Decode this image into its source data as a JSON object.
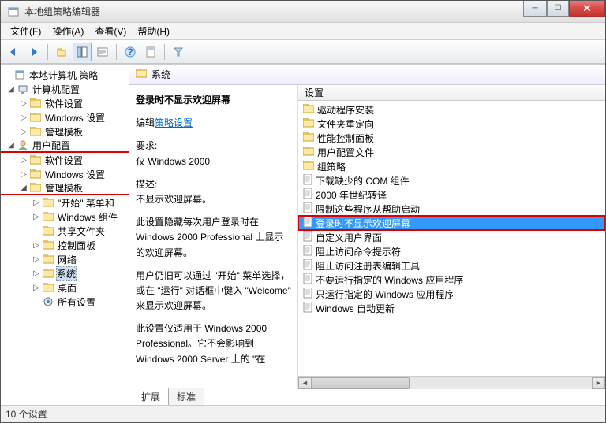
{
  "window": {
    "title": "本地组策略编辑器"
  },
  "menu": {
    "file": "文件(F)",
    "action": "操作(A)",
    "view": "查看(V)",
    "help": "帮助(H)"
  },
  "tree": {
    "root": "本地计算机 策略",
    "computer": "计算机配置",
    "c_soft": "软件设置",
    "c_win": "Windows 设置",
    "c_tmpl": "管理模板",
    "user": "用户配置",
    "u_soft": "软件设置",
    "u_win": "Windows 设置",
    "u_tmpl": "管理模板",
    "t_start": "\"开始\" 菜单和",
    "t_wincomp": "Windows 组件",
    "t_share": "共享文件夹",
    "t_ctrl": "控制面板",
    "t_net": "网络",
    "t_sys": "系统",
    "t_desk": "桌面",
    "t_all": "所有设置"
  },
  "header": {
    "title": "系统"
  },
  "desc": {
    "title": "登录时不显示欢迎屏幕",
    "edit_label": "编辑",
    "edit_link": "策略设置",
    "req_label": "要求:",
    "req_text": "仅 Windows 2000",
    "desc_label": "描述:",
    "desc_text": "不显示欢迎屏幕。",
    "p1": "此设置隐藏每次用户登录时在 Windows 2000 Professional 上显示的欢迎屏幕。",
    "p2": "用户仍旧可以通过 \"开始\" 菜单选择，或在 \"运行\" 对话框中键入 \"Welcome\" 来显示欢迎屏幕。",
    "p3": "此设置仅适用于 Windows 2000 Professional。它不会影响到 Windows 2000 Server 上的 \"在"
  },
  "list": {
    "header": "设置",
    "items": [
      {
        "t": "folder",
        "label": "驱动程序安装"
      },
      {
        "t": "folder",
        "label": "文件夹重定向"
      },
      {
        "t": "folder",
        "label": "性能控制面板"
      },
      {
        "t": "folder",
        "label": "用户配置文件"
      },
      {
        "t": "folder",
        "label": "组策略"
      },
      {
        "t": "setting",
        "label": "下载缺少的 COM 组件"
      },
      {
        "t": "setting",
        "label": "2000 年世纪转译"
      },
      {
        "t": "setting",
        "label": "限制这些程序从帮助启动"
      },
      {
        "t": "setting",
        "label": "登录时不显示欢迎屏幕",
        "selected": true,
        "redbox": true
      },
      {
        "t": "setting",
        "label": "自定义用户界面"
      },
      {
        "t": "setting",
        "label": "阻止访问命令提示符"
      },
      {
        "t": "setting",
        "label": "阻止访问注册表编辑工具"
      },
      {
        "t": "setting",
        "label": "不要运行指定的 Windows 应用程序"
      },
      {
        "t": "setting",
        "label": "只运行指定的 Windows 应用程序"
      },
      {
        "t": "setting",
        "label": "Windows 自动更新"
      }
    ]
  },
  "tabs": {
    "extended": "扩展",
    "standard": "标准"
  },
  "status": "10 个设置"
}
